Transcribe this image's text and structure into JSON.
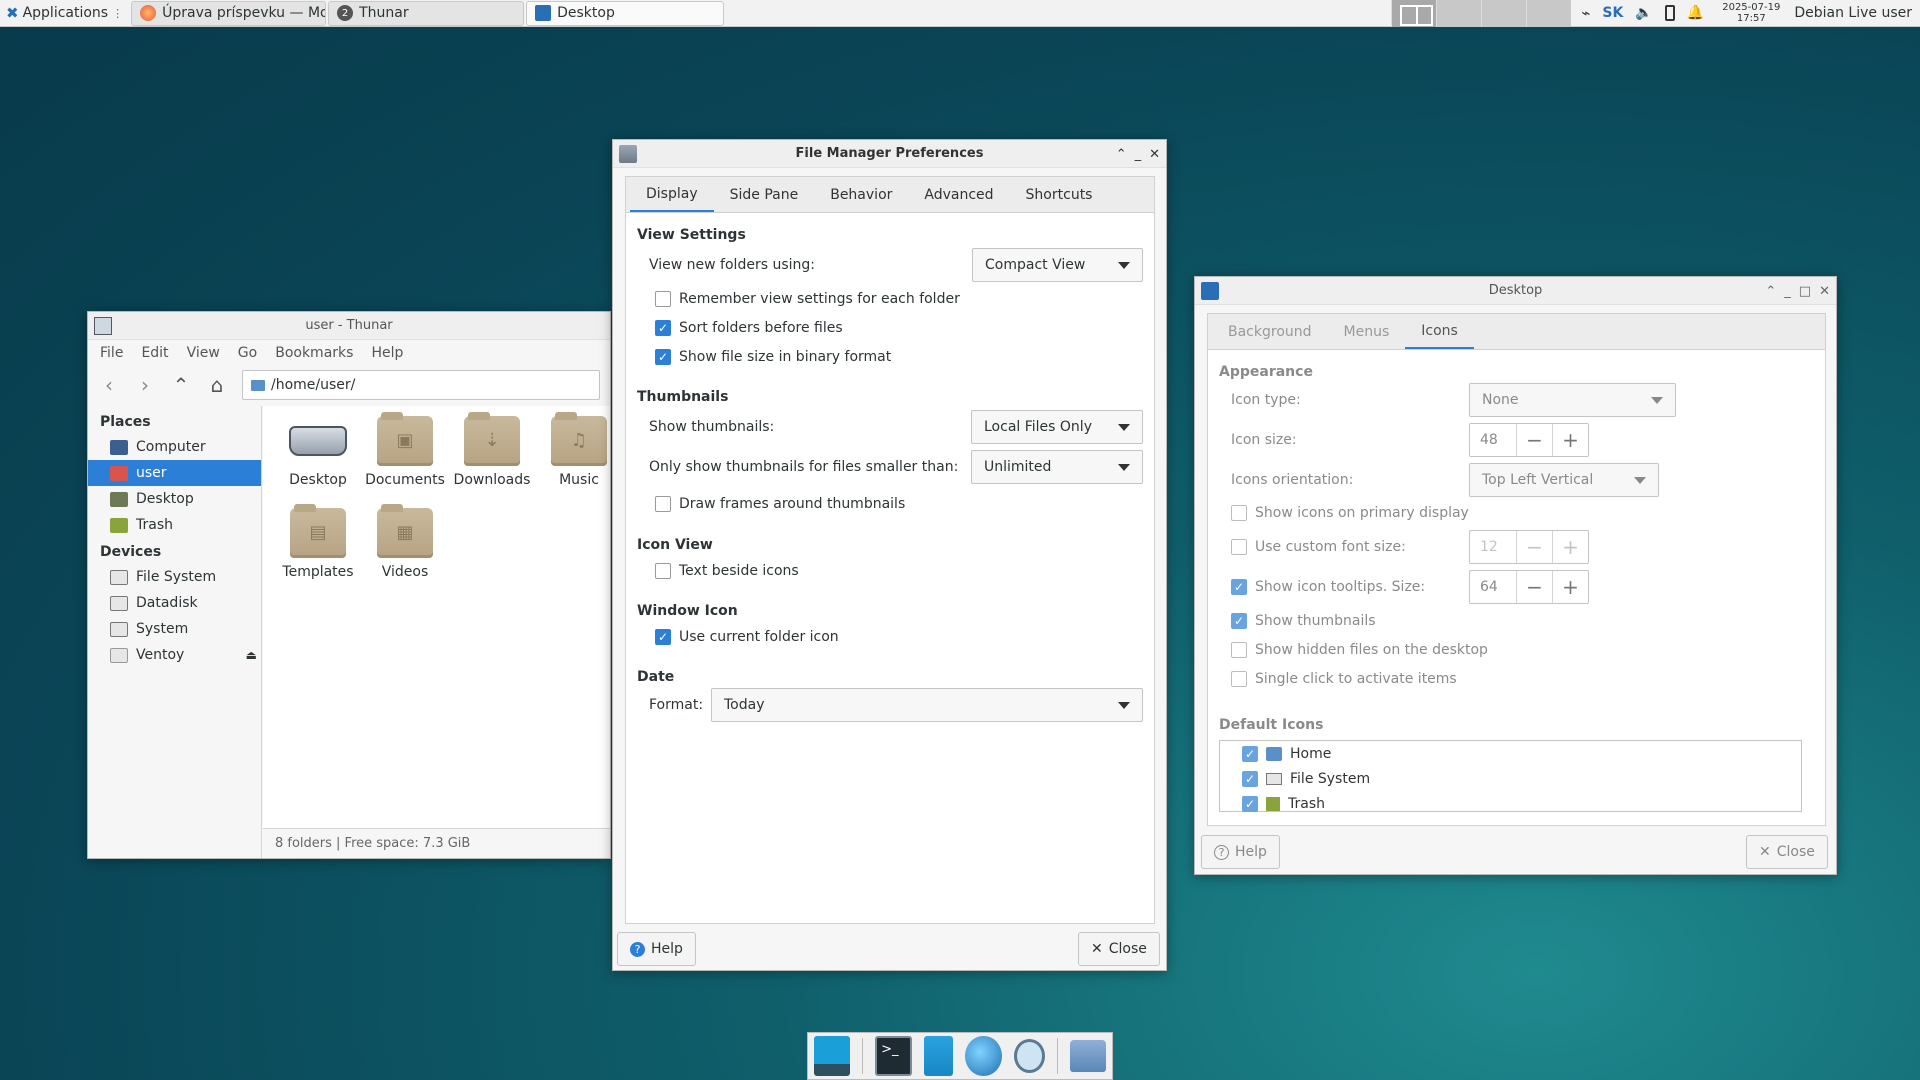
{
  "panel": {
    "apps_label": "Applications",
    "tasks": [
      {
        "label": "Úprava príspevku — Mozil...",
        "icon": "firefox-icon"
      },
      {
        "label": "Thunar",
        "icon": "thunar-icon",
        "badge": "2"
      },
      {
        "label": "Desktop",
        "icon": "desktop-settings-icon"
      }
    ],
    "keyboard_layout": "SK",
    "clock_date": "2025-07-19",
    "clock_time": "17:57",
    "user": "Debian Live user"
  },
  "thunar": {
    "title": "user - Thunar",
    "menu": [
      "File",
      "Edit",
      "View",
      "Go",
      "Bookmarks",
      "Help"
    ],
    "path": "/home/user/",
    "places_header": "Places",
    "places": [
      "Computer",
      "user",
      "Desktop",
      "Trash"
    ],
    "devices_header": "Devices",
    "devices": [
      "File System",
      "Datadisk",
      "System",
      "Ventoy"
    ],
    "files": [
      "Desktop",
      "Documents",
      "Downloads",
      "Music",
      "Templates",
      "Videos"
    ],
    "status": "8 folders  |  Free space: 7.3 GiB"
  },
  "prefs": {
    "title": "File Manager Preferences",
    "tabs": [
      "Display",
      "Side Pane",
      "Behavior",
      "Advanced",
      "Shortcuts"
    ],
    "view_settings": "View Settings",
    "view_new_label": "View new folders using:",
    "view_new_value": "Compact View",
    "remember": "Remember view settings for each folder",
    "sort_folders": "Sort folders before files",
    "binary_size": "Show file size in binary format",
    "thumbnails": "Thumbnails",
    "show_thumbs_label": "Show thumbnails:",
    "show_thumbs_value": "Local Files Only",
    "thumb_limit_label": "Only show thumbnails for files smaller than:",
    "thumb_limit_value": "Unlimited",
    "draw_frames": "Draw frames around thumbnails",
    "icon_view": "Icon View",
    "text_beside": "Text beside icons",
    "window_icon": "Window Icon",
    "use_folder_icon": "Use current folder icon",
    "date": "Date",
    "format_label": "Format:",
    "format_value": "Today",
    "help": "Help",
    "close": "Close"
  },
  "desktop": {
    "title": "Desktop",
    "tabs": [
      "Background",
      "Menus",
      "Icons"
    ],
    "appearance": "Appearance",
    "icon_type_label": "Icon type:",
    "icon_type_value": "None",
    "icon_size_label": "Icon size:",
    "icon_size_value": "48",
    "orientation_label": "Icons orientation:",
    "orientation_value": "Top Left Vertical",
    "primary_display": "Show icons on primary display",
    "custom_font": "Use custom font size:",
    "custom_font_value": "12",
    "tooltips": "Show icon tooltips. Size:",
    "tooltips_value": "64",
    "show_thumbnails": "Show thumbnails",
    "hidden_files": "Show hidden files on the desktop",
    "single_click": "Single click to activate items",
    "default_icons": "Default Icons",
    "default_list": [
      "Home",
      "File System",
      "Trash"
    ],
    "help": "Help",
    "close": "Close"
  },
  "colors": {
    "accent": "#2c7fd6",
    "panel": "#f2f2f2"
  }
}
